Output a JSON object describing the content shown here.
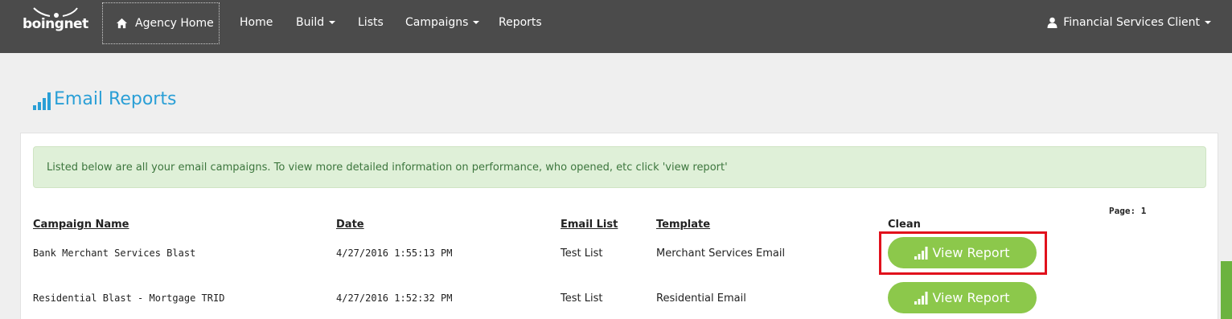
{
  "brand": {
    "logo_text": "boingnet"
  },
  "nav": {
    "agency_home": "Agency Home",
    "items": [
      {
        "label": "Home",
        "has_caret": false
      },
      {
        "label": "Build",
        "has_caret": true
      },
      {
        "label": "Lists",
        "has_caret": false
      },
      {
        "label": "Campaigns",
        "has_caret": true
      },
      {
        "label": "Reports",
        "has_caret": false
      }
    ],
    "user": "Financial Services Client"
  },
  "page": {
    "title": "Email Reports",
    "info": "Listed below are all your email campaigns. To view more detailed information on performance, who opened, etc click 'view report'",
    "pager_label": "Page: 1"
  },
  "table": {
    "headers": {
      "campaign_name": "Campaign Name",
      "date": "Date",
      "email_list": "Email List",
      "template": "Template",
      "clean": "Clean"
    },
    "rows": [
      {
        "campaign_name": "Bank Merchant Services Blast",
        "date": "4/27/2016 1:55:13 PM",
        "email_list": "Test List",
        "template": "Merchant Services Email",
        "action": "View Report",
        "highlighted": true
      },
      {
        "campaign_name": "Residential Blast - Mortgage TRID",
        "date": "4/27/2016 1:52:32 PM",
        "email_list": "Test List",
        "template": "Residential Email",
        "action": "View Report",
        "highlighted": false
      }
    ]
  },
  "colors": {
    "navbar": "#4b4b4b",
    "title_blue": "#2a9fd6",
    "button_green": "#8cc84b",
    "alert_bg": "#dff0d8",
    "alert_text": "#3c763d",
    "highlight_red": "#e1111c"
  },
  "icons": {
    "home": "home-icon",
    "user": "user-icon",
    "title": "signal-bars-icon",
    "button": "signal-bars-icon"
  }
}
